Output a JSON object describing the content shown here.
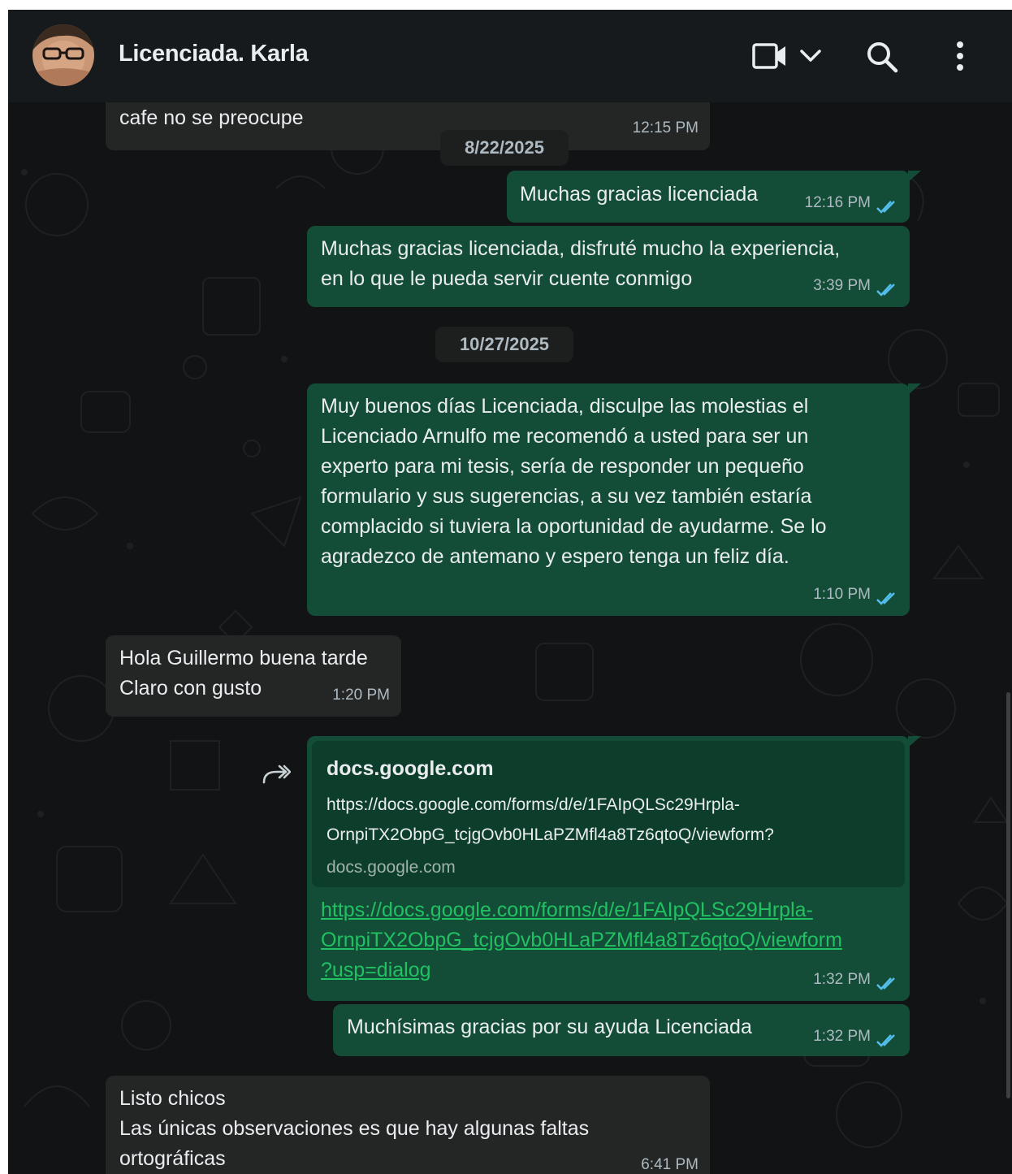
{
  "header": {
    "contact_name": "Licenciada. Karla",
    "icons": [
      "video-call-icon",
      "chevron-down-icon",
      "search-icon",
      "menu-dots-icon"
    ]
  },
  "colors": {
    "app_background": "#111314",
    "header_background": "#171a1c",
    "incoming_bubble": "#242626",
    "outgoing_bubble": "#144d37",
    "link_color": "#21c063",
    "read_ticks": "#53bdeb"
  },
  "messages": [
    {
      "direction": "in",
      "text": "cafe no se preocupe",
      "time": "12:15 PM"
    },
    {
      "type": "date",
      "text": "8/22/2025"
    },
    {
      "direction": "out",
      "text": "Muchas gracias licenciada",
      "time": "12:16 PM",
      "status": "read"
    },
    {
      "direction": "out",
      "text": "Muchas gracias licenciada, disfruté mucho la experiencia,\nen lo que le pueda servir cuente conmigo",
      "time": "3:39 PM",
      "status": "read"
    },
    {
      "type": "date",
      "text": "10/27/2025"
    },
    {
      "direction": "out",
      "text": "Muy buenos días Licenciada, disculpe las molestias el\nLicenciado Arnulfo me recomendó a usted para ser un\nexperto para mi tesis, sería de responder un pequeño\nformulario y sus sugerencias, a su vez también estaría\ncomplacido si tuviera la oportunidad de ayudarme. Se lo\nagradezco de antemano y espero tenga un feliz día.",
      "time": "1:10 PM",
      "status": "read"
    },
    {
      "direction": "in",
      "text": "Hola Guillermo buena tarde\nClaro con gusto",
      "time": "1:20 PM"
    },
    {
      "direction": "out",
      "preview": {
        "domain": "docs.google.com",
        "url": "https://docs.google.com/forms/d/e/1FAIpQLSc29Hrpla-\nOrnpiTX2ObpG_tcjgOvb0HLaPZMfl4a8Tz6qtoQ/viewform?",
        "site": "docs.google.com"
      },
      "link": "https://docs.google.com/forms/d/e/1FAIpQLSc29Hrpla-\nOrnpiTX2ObpG_tcjgOvb0HLaPZMfl4a8Tz6qtoQ/viewform\n?usp=dialog",
      "time": "1:32 PM",
      "status": "read",
      "action_icon": "forward-icon"
    },
    {
      "direction": "out",
      "text": "Muchísimas gracias por su ayuda Licenciada",
      "time": "1:32 PM",
      "status": "read"
    },
    {
      "direction": "in",
      "text": "Listo chicos\nLas únicas observaciones es que hay algunas faltas\nortográficas",
      "time": "6:41 PM"
    }
  ]
}
